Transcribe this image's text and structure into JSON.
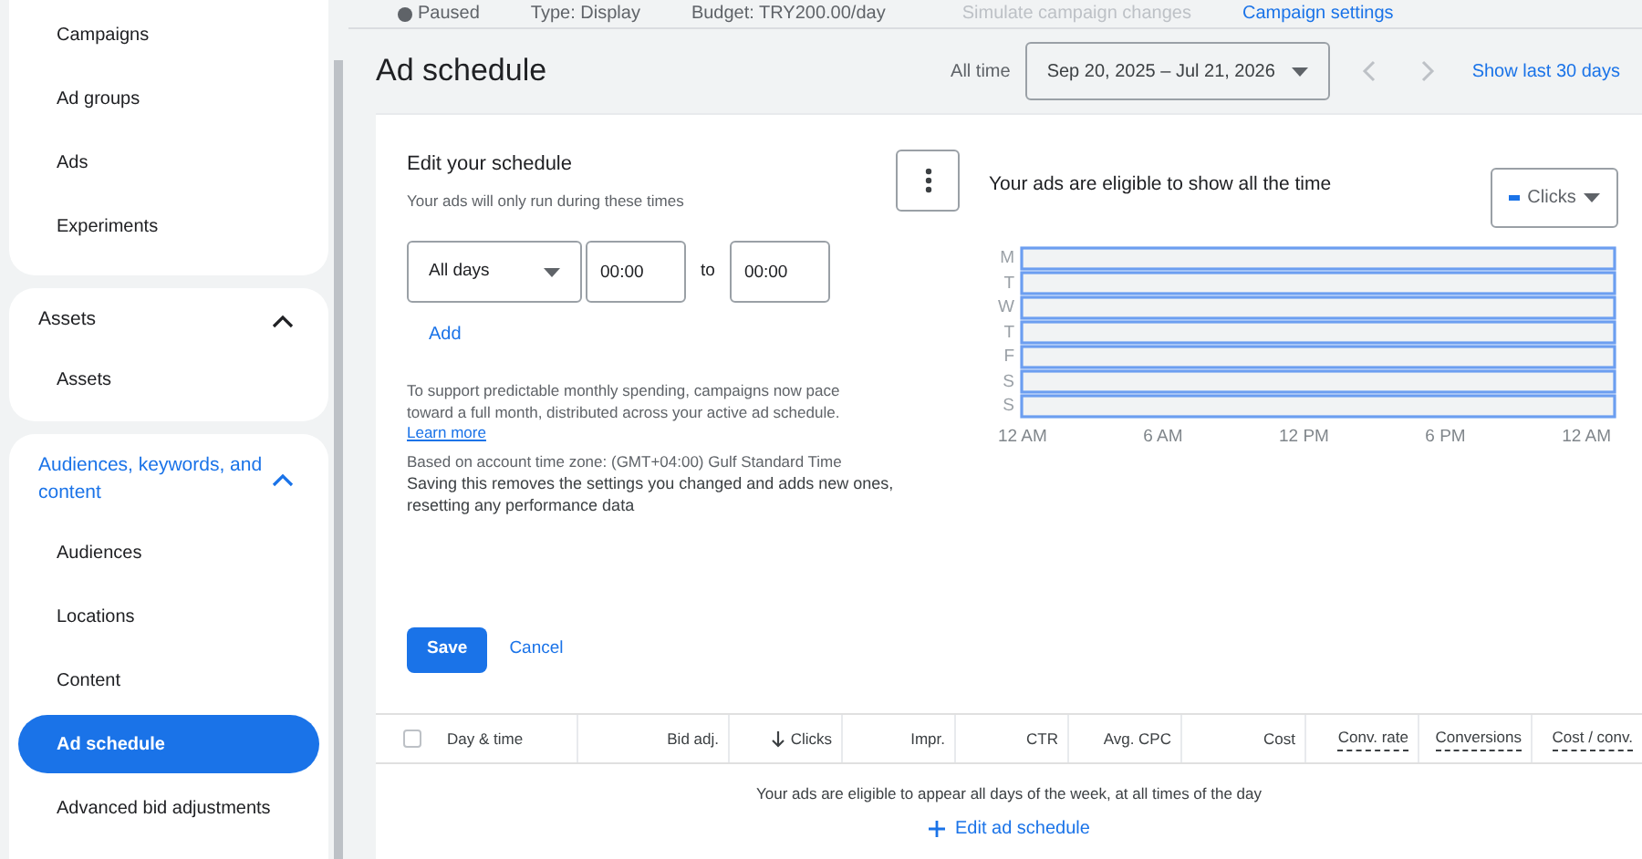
{
  "top_bar": {
    "status": "Paused",
    "type": "Type: Display",
    "budget": "Budget: TRY200.00/day",
    "simulate": "Simulate campaign changes",
    "settings": "Campaign settings"
  },
  "sidebar": {
    "groups": [
      {
        "items": [
          {
            "label": "Campaigns",
            "selected": false
          },
          {
            "label": "Ad groups",
            "selected": false
          },
          {
            "label": "Ads",
            "selected": false
          },
          {
            "label": "Experiments",
            "selected": false
          }
        ]
      },
      {
        "heading": "Assets",
        "heading_active": false,
        "expanded": true,
        "items": [
          {
            "label": "Assets",
            "selected": false
          }
        ]
      },
      {
        "heading": "Audiences, keywords, and content",
        "heading_active": true,
        "expanded": true,
        "items": [
          {
            "label": "Audiences",
            "selected": false
          },
          {
            "label": "Locations",
            "selected": false
          },
          {
            "label": "Content",
            "selected": false
          },
          {
            "label": "Ad schedule",
            "selected": true
          },
          {
            "label": "Advanced bid adjustments",
            "selected": false
          }
        ]
      }
    ]
  },
  "page": {
    "title": "Ad schedule",
    "range_label": "All time",
    "date_range": "Sep 20, 2025 – Jul 21, 2026",
    "show_last": "Show last 30 days"
  },
  "editor": {
    "title": "Edit your schedule",
    "subtitle": "Your ads will only run during these times",
    "day_select": "All days",
    "start": "00:00",
    "to": "to",
    "end": "00:00",
    "add": "Add",
    "pacing_note": "To support predictable monthly spending, campaigns now pace toward a full month, distributed across your active ad schedule.",
    "learn_more": "Learn more",
    "timezone": "Based on account time zone: (GMT+04:00) Gulf Standard Time",
    "warning": "Saving this removes the settings you changed and adds new ones, resetting any performance data",
    "save": "Save",
    "cancel": "Cancel"
  },
  "heatmap": {
    "title": "Your ads are eligible to show all the time",
    "metric": "Clicks",
    "days": [
      "M",
      "T",
      "W",
      "T",
      "F",
      "S",
      "S"
    ],
    "times": [
      "12 AM",
      "6 AM",
      "12 PM",
      "6 PM",
      "12 AM"
    ]
  },
  "table": {
    "select_all_checked": false,
    "columns": [
      {
        "label": "Day & time",
        "underlined": false,
        "sorted": false
      },
      {
        "label": "Bid adj.",
        "underlined": false,
        "sorted": false
      },
      {
        "label": "Clicks",
        "underlined": false,
        "sorted": true
      },
      {
        "label": "Impr.",
        "underlined": false,
        "sorted": false
      },
      {
        "label": "CTR",
        "underlined": false,
        "sorted": false
      },
      {
        "label": "Avg. CPC",
        "underlined": false,
        "sorted": false
      },
      {
        "label": "Cost",
        "underlined": false,
        "sorted": false
      },
      {
        "label": "Conv. rate",
        "underlined": true,
        "sorted": false
      },
      {
        "label": "Conversions",
        "underlined": true,
        "sorted": false
      },
      {
        "label": "Cost / conv.",
        "underlined": true,
        "sorted": false
      }
    ],
    "empty_message": "Your ads are eligible to appear all days of the week, at all times of the day",
    "edit_link": "Edit ad schedule"
  }
}
